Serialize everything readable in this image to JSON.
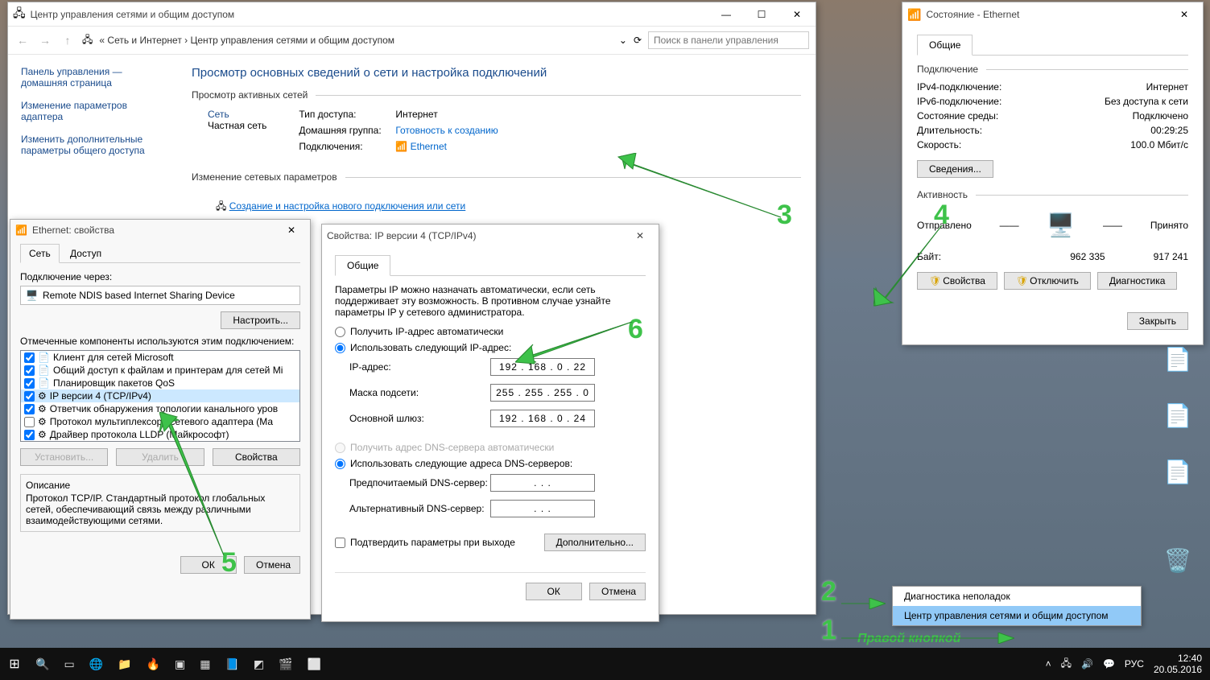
{
  "nc": {
    "title": "Центр управления сетями и общим доступом",
    "breadcrumb_part1": "Сеть и Интернет",
    "breadcrumb_part2": "Центр управления сетями и общим доступом",
    "search_placeholder": "Поиск в панели управления",
    "side": {
      "home": "Панель управления — домашняя страница",
      "adapter": "Изменение параметров адаптера",
      "sharing": "Изменить дополнительные параметры общего доступа"
    },
    "main_heading": "Просмотр основных сведений о сети и настройка подключений",
    "active_label": "Просмотр активных сетей",
    "net_name": "Сеть",
    "net_type": "Частная сеть",
    "access_lbl": "Тип доступа:",
    "access_val": "Интернет",
    "group_lbl": "Домашняя группа:",
    "group_link": "Готовность к созданию",
    "conn_lbl": "Подключения:",
    "conn_link": "Ethernet",
    "change_label": "Изменение сетевых параметров",
    "newconn_link": "Создание и настройка нового подключения или сети"
  },
  "status": {
    "title": "Состояние - Ethernet",
    "tab": "Общие",
    "conn_hdr": "Подключение",
    "rows": {
      "ipv4l": "IPv4-подключение:",
      "ipv4v": "Интернет",
      "ipv6l": "IPv6-подключение:",
      "ipv6v": "Без доступа к сети",
      "medial": "Состояние среды:",
      "mediav": "Подключено",
      "durl": "Длительность:",
      "durv": "00:29:25",
      "speedl": "Скорость:",
      "speedv": "100.0 Мбит/с"
    },
    "details_btn": "Сведения...",
    "activity_hdr": "Активность",
    "sent": "Отправлено",
    "recv": "Принято",
    "bytes_lbl": "Байт:",
    "sent_n": "962 335",
    "recv_n": "917 241",
    "props_btn": "Свойства",
    "disable_btn": "Отключить",
    "diag_btn": "Диагностика",
    "close_btn": "Закрыть"
  },
  "eprop": {
    "title": "Ethernet: свойства",
    "tab_net": "Сеть",
    "tab_access": "Доступ",
    "connect_via": "Подключение через:",
    "device": "Remote NDIS based Internet Sharing Device",
    "configure_btn": "Настроить...",
    "components_label": "Отмеченные компоненты используются этим подключением:",
    "items": [
      "Клиент для сетей Microsoft",
      "Общий доступ к файлам и принтерам для сетей Mi",
      "Планировщик пакетов QoS",
      "IP версии 4 (TCP/IPv4)",
      "Ответчик обнаружения топологии канального уров",
      "Протокол мультиплексора сетевого адаптера (Ма",
      "Драйвер протокола LLDP (Майкрософт)"
    ],
    "install_btn": "Установить...",
    "remove_btn": "Удалить",
    "props_btn": "Свойства",
    "desc_hdr": "Описание",
    "desc_txt": "Протокол TCP/IP. Стандартный протокол глобальных сетей, обеспечивающий связь между различными взаимодействующими сетями.",
    "ok": "ОК",
    "cancel": "Отмена"
  },
  "ip": {
    "title": "Свойства: IP версии 4 (TCP/IPv4)",
    "tab": "Общие",
    "intro": "Параметры IP можно назначать автоматически, если сеть поддерживает эту возможность. В противном случае узнайте параметры IP у сетевого администратора.",
    "r_auto_ip": "Получить IP-адрес автоматически",
    "r_man_ip": "Использовать следующий IP-адрес:",
    "ip_lbl": "IP-адрес:",
    "ip_val": "192 . 168 .  0  . 22",
    "mask_lbl": "Маска подсети:",
    "mask_val": "255 . 255 . 255 .  0",
    "gw_lbl": "Основной шлюз:",
    "gw_val": "192 . 168 .  0  . 24",
    "r_auto_dns": "Получить адрес DNS-сервера автоматически",
    "r_man_dns": "Использовать следующие адреса DNS-серверов:",
    "dns1_lbl": "Предпочитаемый DNS-сервер:",
    "dns1_val": ".       .       .",
    "dns2_lbl": "Альтернативный DNS-сервер:",
    "dns2_val": ".       .       .",
    "validate": "Подтвердить параметры при выходе",
    "advanced": "Дополнительно...",
    "ok": "ОК",
    "cancel": "Отмена"
  },
  "ctx": {
    "diag": "Диагностика неполадок",
    "center": "Центр управления сетями и общим доступом"
  },
  "taskbar": {
    "lang": "РУС",
    "time": "12:40",
    "date": "20.05.2016"
  },
  "anno": {
    "rk": "Правой кнопкой"
  }
}
